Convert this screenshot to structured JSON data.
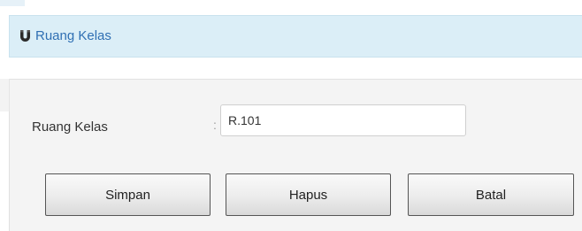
{
  "header": {
    "icon": "magnet-icon",
    "title": "Ruang Kelas"
  },
  "form": {
    "field_label": "Ruang Kelas",
    "separator": ":",
    "field_value": "R.101"
  },
  "buttons": {
    "save_label": "Simpan",
    "delete_label": "Hapus",
    "cancel_label": "Batal"
  },
  "colors": {
    "header_bg": "#dbeef7",
    "header_text": "#2f6fb3",
    "panel_bg": "#f4f4f4"
  }
}
